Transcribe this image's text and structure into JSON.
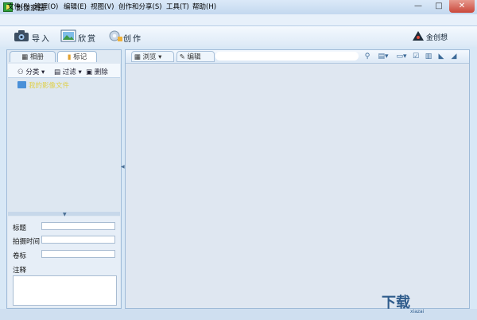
{
  "window": {
    "title": "影像家园",
    "controls": {
      "minimize": "—",
      "maximize": "□",
      "close": "✕"
    }
  },
  "menu": {
    "items": [
      "文件(F)",
      "管理(O)",
      "编辑(E)",
      "视图(V)",
      "创作和分享(S)",
      "工具(T)",
      "帮助(H)"
    ]
  },
  "toolbar": {
    "import_label": "导入",
    "view_label": "欣赏",
    "create_label": "创作",
    "brand": "金创想",
    "icons": [
      "camera-icon",
      "picture-icon",
      "gear-icon",
      "brand-logo"
    ]
  },
  "left": {
    "tabs": {
      "album": "相册",
      "notes": "标记"
    },
    "actions": {
      "category": "分类",
      "filter": "过滤",
      "delete": "删除"
    },
    "tree": {
      "root_label": "我的影像文件"
    },
    "props": {
      "title_label": "标题",
      "time_label": "拍摄时间",
      "mark_label": "卷标",
      "note_label": "注释"
    }
  },
  "right": {
    "tabs": {
      "browse": "浏览",
      "edit": "编辑"
    },
    "icons": [
      "search-icon",
      "view-mode-icon",
      "sort-icon",
      "check-icon",
      "trash-icon",
      "rotate-left-icon",
      "rotate-right-icon"
    ]
  },
  "watermark": {
    "text": "下载",
    "sub": "xiazai"
  },
  "colors": {
    "accent": "#4a90d8",
    "close": "#c9473a",
    "panel": "#dfe9f3"
  }
}
